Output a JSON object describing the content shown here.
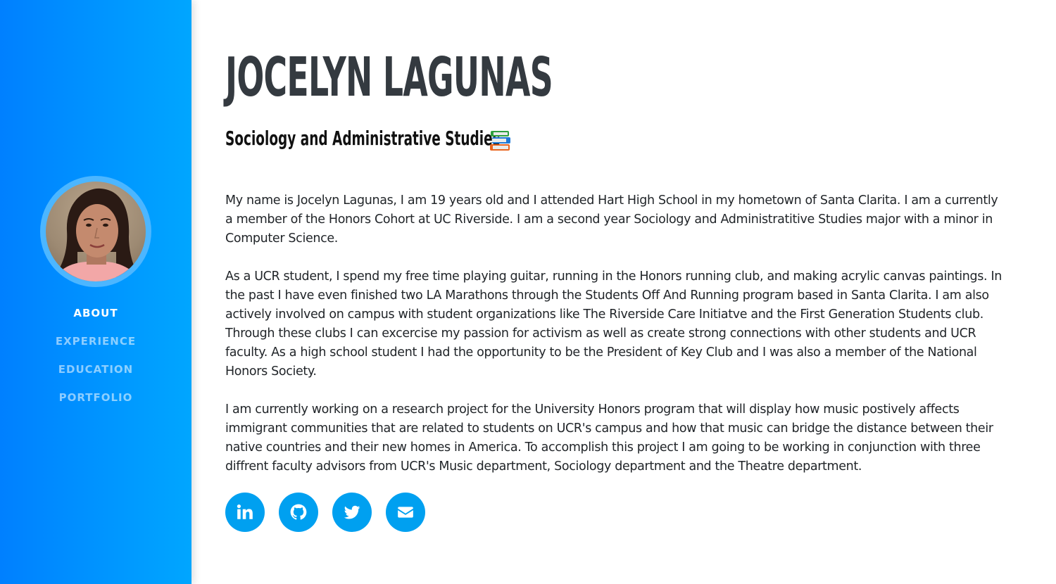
{
  "profile": {
    "name": "JOCELYN LAGUNAS",
    "subtitle": "Sociology and Administrative Studies"
  },
  "nav": {
    "items": [
      {
        "label": "ABOUT",
        "active": true
      },
      {
        "label": "EXPERIENCE",
        "active": false
      },
      {
        "label": "EDUCATION",
        "active": false
      },
      {
        "label": "PORTFOLIO",
        "active": false
      }
    ]
  },
  "bio": {
    "paragraphs": [
      "My name is Jocelyn Lagunas, I am 19 years old and I attended Hart High School in my hometown of Santa Clarita. I am a currently a member of the Honors Cohort at UC Riverside. I am a second year Sociology and Administratitive Studies major with a minor in Computer Science.",
      "As a UCR student, I spend my free time playing guitar, running in the Honors running club, and making acrylic canvas paintings. In the past I have even finished two LA Marathons through the Students Off And Running program based in Santa Clarita. I am also actively involved on campus with student organizations like The Riverside Care Initiatve and the First Generation Students club. Through these clubs I can excercise my passion for activism as well as create strong connections with other students and UCR faculty. As a high school student I had the opportunity to be the President of Key Club and I was also a member of the National Honors Society.",
      "I am currently working on a research project for the University Honors program that will display how music postively affects immigrant communities that are related to students on UCR's campus and how that music can bridge the distance between their native countries and their new homes in America. To accomplish this project I am going to be working in conjunction with three diffrent faculty advisors from UCR's Music department, Sociology department and the Theatre department."
    ]
  },
  "socials": [
    {
      "icon": "linkedin-icon"
    },
    {
      "icon": "github-icon"
    },
    {
      "icon": "twitter-icon"
    },
    {
      "icon": "envelope-icon"
    }
  ],
  "colors": {
    "sidebar_start": "#0080ff",
    "sidebar_end": "#00a6ff",
    "accent": "#00a0f0",
    "heading": "#343a40"
  }
}
